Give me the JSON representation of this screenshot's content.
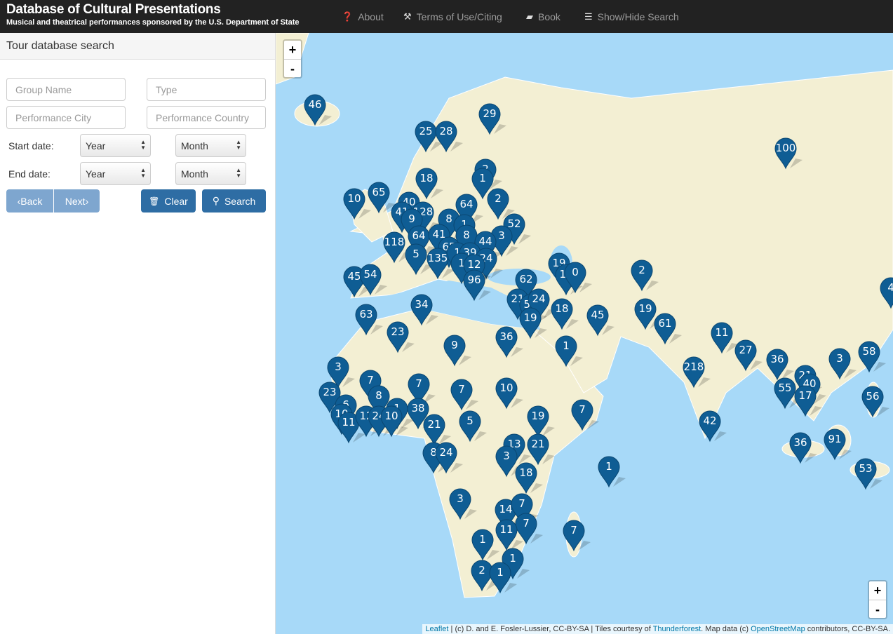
{
  "header": {
    "title": "Database of Cultural Presentations",
    "subtitle": "Musical and theatrical performances sponsored by the U.S. Department of State",
    "nav": [
      {
        "icon": "question-circle-icon",
        "label": "About"
      },
      {
        "icon": "gavel-icon",
        "label": "Terms of Use/Citing"
      },
      {
        "icon": "book-icon",
        "label": "Book"
      },
      {
        "icon": "list-icon",
        "label": "Show/Hide Search"
      }
    ]
  },
  "sidebar": {
    "title": "Tour database search",
    "placeholders": {
      "group": "Group Name",
      "type": "Type",
      "city": "Performance City",
      "country": "Performance Country"
    },
    "start_label": "Start date:",
    "end_label": "End date:",
    "year": "Year",
    "month": "Month",
    "back": "Back",
    "next": "Next",
    "clear": "Clear",
    "search": "Search"
  },
  "map": {
    "zoom_in": "+",
    "zoom_out": "-",
    "marker_color": "#0f5d94",
    "markers": [
      "46",
      "29",
      "25",
      "28",
      "100",
      "2",
      "1",
      "18",
      "2",
      "10",
      "65",
      "40",
      "41",
      "128",
      "9",
      "64",
      "8",
      "1",
      "52",
      "64",
      "41",
      "8",
      "3",
      "44",
      "118",
      "65",
      "1",
      "39",
      "5",
      "135",
      "24",
      "1",
      "12",
      "19",
      "10",
      "0",
      "2",
      "45",
      "54",
      "96",
      "62",
      "21",
      "56",
      "24",
      "18",
      "45",
      "19",
      "34",
      "63",
      "19",
      "61",
      "23",
      "36",
      "11",
      "9",
      "1",
      "27",
      "3",
      "36",
      "218",
      "3",
      "58",
      "21",
      "40",
      "55",
      "17",
      "7",
      "7",
      "23",
      "7",
      "10",
      "8",
      "6",
      "38",
      "1",
      "10",
      "11",
      "12",
      "24",
      "10",
      "7",
      "56",
      "19",
      "42",
      "21",
      "5",
      "13",
      "21",
      "36",
      "91",
      "8",
      "24",
      "3",
      "1",
      "18",
      "53",
      "3",
      "14",
      "7",
      "7",
      "11",
      "7",
      "1",
      "1",
      "2",
      "1",
      "4"
    ],
    "attribution": {
      "leaflet": "Leaflet",
      "text1": " | (c) D. and E. Fosler-Lussier, CC-BY-SA | Tiles courtesy of ",
      "thunderforest": "Thunderforest",
      "text2": ". Map data (c) ",
      "osm": "OpenStreetMap",
      "text3": " contributors, CC-BY-SA."
    }
  }
}
